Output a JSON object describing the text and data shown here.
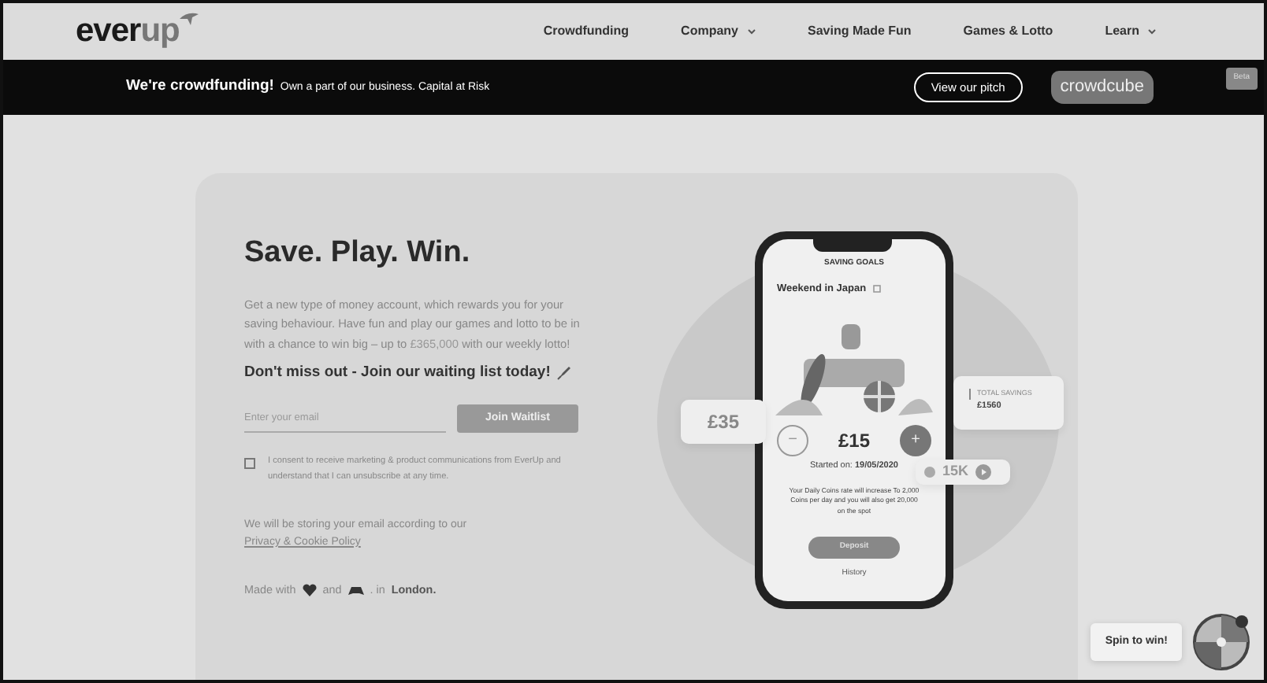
{
  "nav": {
    "logo": "everup",
    "links": [
      {
        "label": "Crowdfunding",
        "dropdown": false
      },
      {
        "label": "Company",
        "dropdown": true
      },
      {
        "label": "Saving Made Fun",
        "dropdown": false
      },
      {
        "label": "Games & Lotto",
        "dropdown": false
      },
      {
        "label": "Learn",
        "dropdown": true
      }
    ]
  },
  "banner": {
    "headline": "We're crowdfunding!",
    "text": "Own a part of our business. Capital at Risk",
    "button": "View our pitch",
    "partner": "crowdcube",
    "badge": "Beta"
  },
  "hero": {
    "title": "Save. Play. Win.",
    "paragraph": "Get a new type of money account, which rewards you for your saving behaviour. Have fun and play our games and lotto to be in with a chance to win big – up to ",
    "amount": "£365,000",
    "paragraph_end": " with our weekly lotto!",
    "cta": "Don't miss out - Join our waiting list today!",
    "email": {
      "placeholder": "Enter your email"
    },
    "join_button": "Join Waitlist",
    "consent": {
      "label": "I consent to receive marketing & product communications from EverUp and understand that I can unsubscribe at any time.",
      "checked": false
    },
    "storage_note": "We will be storing your email according to our ",
    "policy_link": "Privacy & Cookie Policy",
    "made_with": "Made with",
    "and": "and",
    "in": ". in",
    "city": "London."
  },
  "phone": {
    "header": "SAVING GOALS",
    "goal": "Weekend in Japan",
    "minus": "−",
    "amount": "£15",
    "plus": "+",
    "started_label": "Started on:",
    "started_date": "19/05/2020",
    "info": "Your Daily Coins rate will increase To 2,000 Coins per day and you will also get 20,000 on the spot",
    "deposit": "Deposit",
    "history": "History"
  },
  "floating": {
    "left_amount": "£35",
    "total_label": "TOTAL SAVINGS",
    "total_value": "£1560",
    "coins": "15K"
  },
  "spin": {
    "label": "Spin to win!"
  }
}
